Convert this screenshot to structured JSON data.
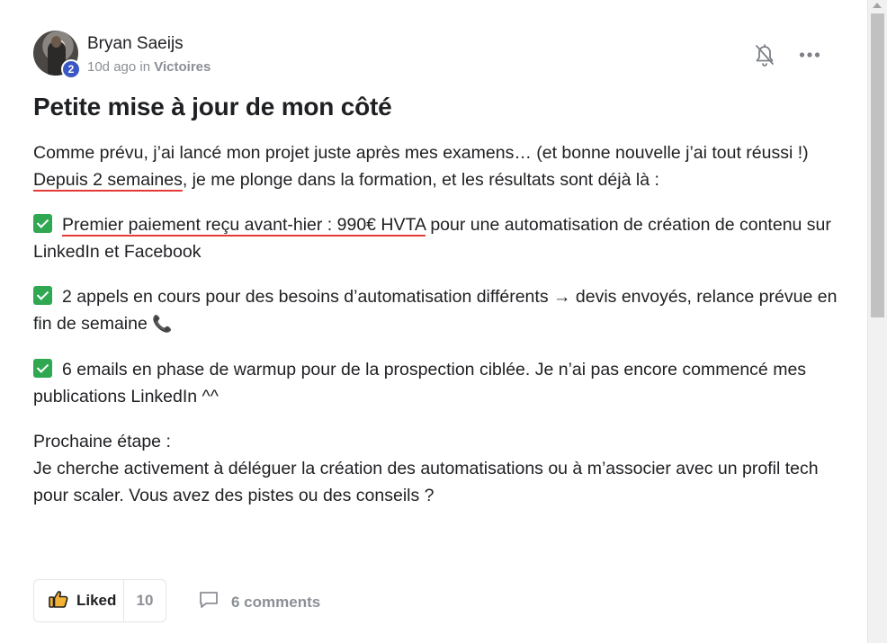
{
  "post": {
    "author": {
      "name": "Bryan Saeijs",
      "level": "2",
      "time_ago": "10d ago",
      "in_label": "in",
      "category": "Victoires"
    },
    "title": "Petite mise à jour de mon côté",
    "body": {
      "p1_line1": "Comme prévu, j’ai lancé mon projet juste après mes examens… (et bonne nouvelle j’ai tout réussi !)",
      "p1_underlined": "Depuis 2 semaines",
      "p1_rest": ", je me plonge dans la formation, et les résultats sont déjà là :",
      "item1_underlined": "Premier paiement reçu avant-hier : 990€ HVTA",
      "item1_rest": " pour une automatisation de création de contenu sur LinkedIn et Facebook",
      "item2": "2 appels en cours pour des besoins d’automatisation différents → devis envoyés, relance prévue en fin de semaine",
      "item2_emoji": "📞",
      "item3": "6 emails en phase de warmup pour de la prospection ciblée. Je n’ai pas encore commencé mes publications LinkedIn ^^",
      "next_heading": "Prochaine étape :",
      "next_text": "Je cherche activement à déléguer la création des automatisations ou à m’associer avec un profil tech pour scaler. Vous avez des pistes ou des conseils ?"
    },
    "footer": {
      "like_label": "Liked",
      "like_count": "10",
      "comments_label": "6 comments"
    }
  },
  "icons": {
    "bell": "bell-off-icon",
    "more": "more-horizontal-icon",
    "thumb": "thumbs-up-icon",
    "comment": "comment-icon",
    "check": "check-box-icon"
  },
  "colors": {
    "badge": "#3b57c4",
    "check": "#30a852",
    "underline": "#e53935",
    "muted": "#8b8f96"
  }
}
